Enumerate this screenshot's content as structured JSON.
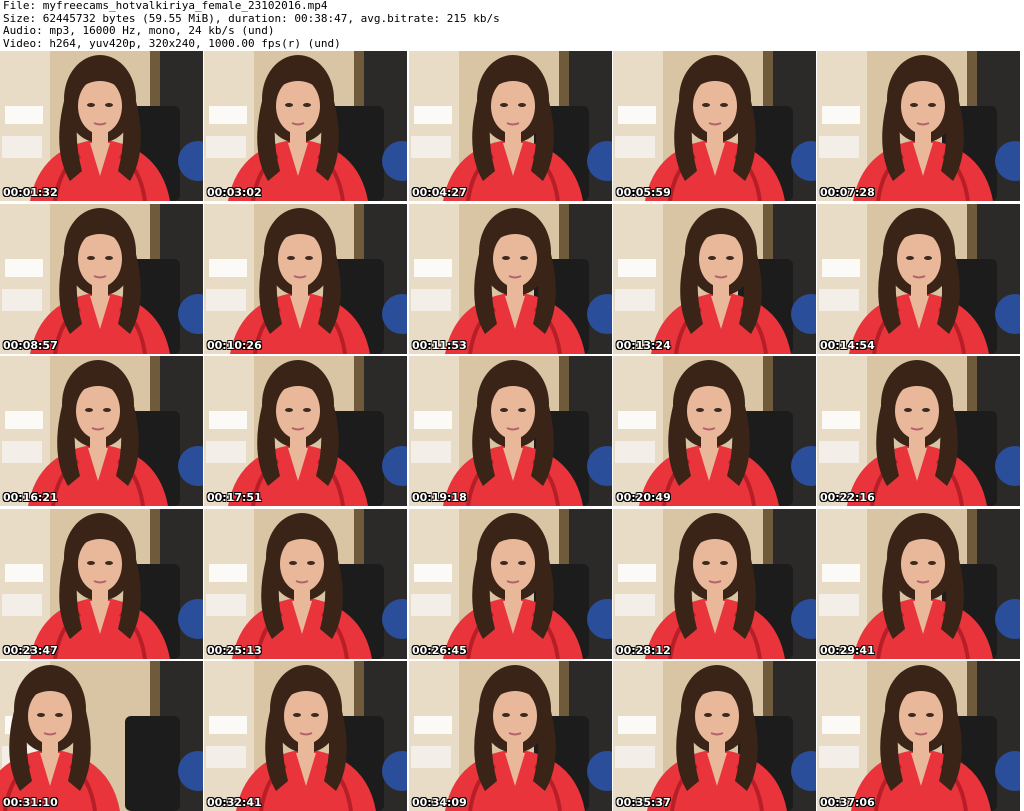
{
  "header": {
    "file_line": "File: myfreecams_hotvalkiriya_female_23102016.mp4",
    "size_line": "Size: 62445732 bytes (59.55 MiB), duration: 00:38:47, avg.bitrate: 215 kb/s",
    "audio_line": "Audio: mp3, 16000 Hz, mono, 24 kb/s (und)",
    "video_line": "Video: h264, yuv420p, 320x240, 1000.00 fps(r) (und)"
  },
  "thumbnails": [
    {
      "timestamp": "00:01:32"
    },
    {
      "timestamp": "00:03:02"
    },
    {
      "timestamp": "00:04:27"
    },
    {
      "timestamp": "00:05:59"
    },
    {
      "timestamp": "00:07:28"
    },
    {
      "timestamp": "00:08:57"
    },
    {
      "timestamp": "00:10:26"
    },
    {
      "timestamp": "00:11:53"
    },
    {
      "timestamp": "00:13:24"
    },
    {
      "timestamp": "00:14:54"
    },
    {
      "timestamp": "00:16:21"
    },
    {
      "timestamp": "00:17:51"
    },
    {
      "timestamp": "00:19:18"
    },
    {
      "timestamp": "00:20:49"
    },
    {
      "timestamp": "00:22:16"
    },
    {
      "timestamp": "00:23:47"
    },
    {
      "timestamp": "00:25:13"
    },
    {
      "timestamp": "00:26:45"
    },
    {
      "timestamp": "00:28:12"
    },
    {
      "timestamp": "00:29:41"
    },
    {
      "timestamp": "00:31:10"
    },
    {
      "timestamp": "00:32:41"
    },
    {
      "timestamp": "00:34:09"
    },
    {
      "timestamp": "00:35:37"
    },
    {
      "timestamp": "00:37:06"
    }
  ],
  "colors": {
    "robe": "#e8343a",
    "robe_shade": "#b81e28",
    "hair": "#3a2418",
    "skin": "#e9b89a",
    "wall": "#d9c4a4",
    "chair": "#1c1c1c",
    "ball": "#2a4e9a"
  }
}
